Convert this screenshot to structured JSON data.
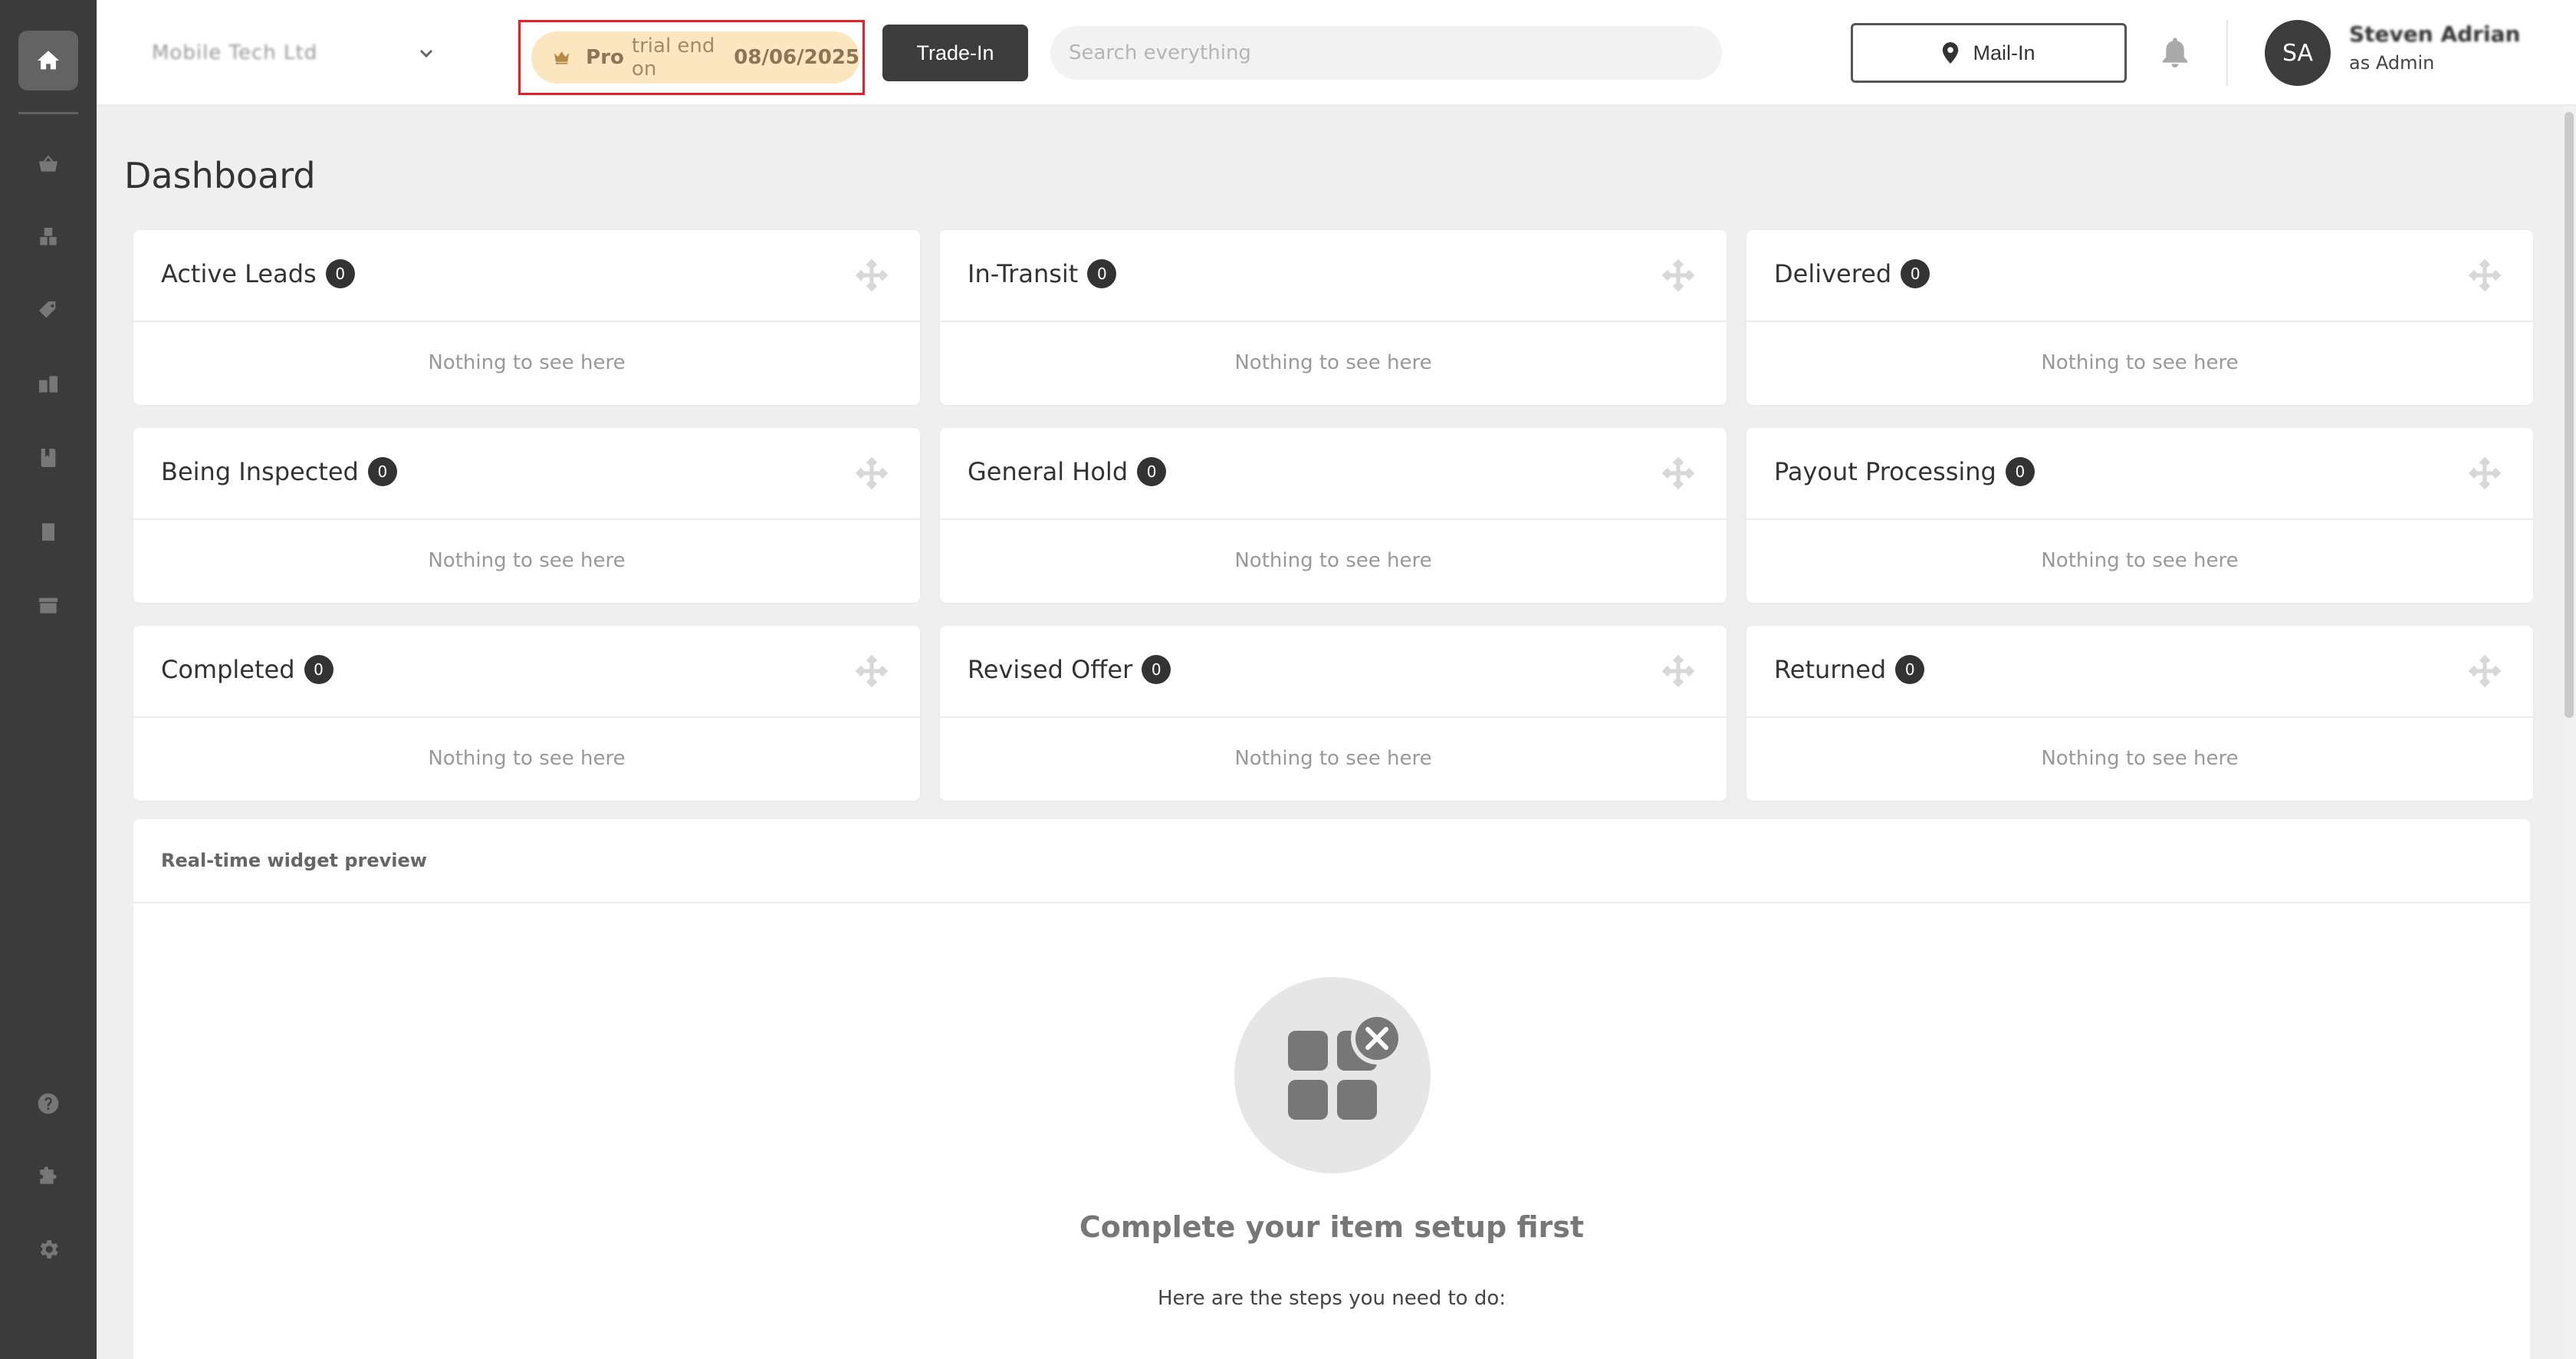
{
  "account": {
    "name": "Mobile Tech Ltd"
  },
  "trial": {
    "plan": "Pro",
    "text": "trial end on",
    "date": "08/06/2025"
  },
  "toolbar": {
    "tradein_label": "Trade-In",
    "mailin_label": "Mail-In"
  },
  "search": {
    "placeholder": "Search everything"
  },
  "user": {
    "initials": "SA",
    "name": "Steven Adrian",
    "role": "as Admin"
  },
  "page": {
    "title": "Dashboard"
  },
  "cards": [
    {
      "title": "Active Leads",
      "count": "0",
      "empty": "Nothing to see here"
    },
    {
      "title": "In-Transit",
      "count": "0",
      "empty": "Nothing to see here"
    },
    {
      "title": "Delivered",
      "count": "0",
      "empty": "Nothing to see here"
    },
    {
      "title": "Being Inspected",
      "count": "0",
      "empty": "Nothing to see here"
    },
    {
      "title": "General Hold",
      "count": "0",
      "empty": "Nothing to see here"
    },
    {
      "title": "Payout Processing",
      "count": "0",
      "empty": "Nothing to see here"
    },
    {
      "title": "Completed",
      "count": "0",
      "empty": "Nothing to see here"
    },
    {
      "title": "Revised Offer",
      "count": "0",
      "empty": "Nothing to see here"
    },
    {
      "title": "Returned",
      "count": "0",
      "empty": "Nothing to see here"
    }
  ],
  "preview": {
    "title": "Real-time widget preview",
    "empty_title": "Complete your item setup first",
    "empty_subtitle": "Here are the steps you need to do:"
  },
  "icons": {
    "sidebar": [
      "home-icon",
      "basket-icon",
      "inventory-icon",
      "tag-icon",
      "boxes-icon",
      "book-icon",
      "clipboard-icon",
      "archive-icon",
      "help-icon",
      "puzzle-icon",
      "gear-icon"
    ],
    "top": [
      "chevron-down-icon",
      "crown-icon",
      "map-pin-icon",
      "bell-icon"
    ]
  },
  "colors": {
    "sidebar_bg": "#3b3b3b",
    "trial_bg": "#fbe6c0",
    "highlight_border": "#e5202a",
    "badge_bg": "#333333"
  }
}
